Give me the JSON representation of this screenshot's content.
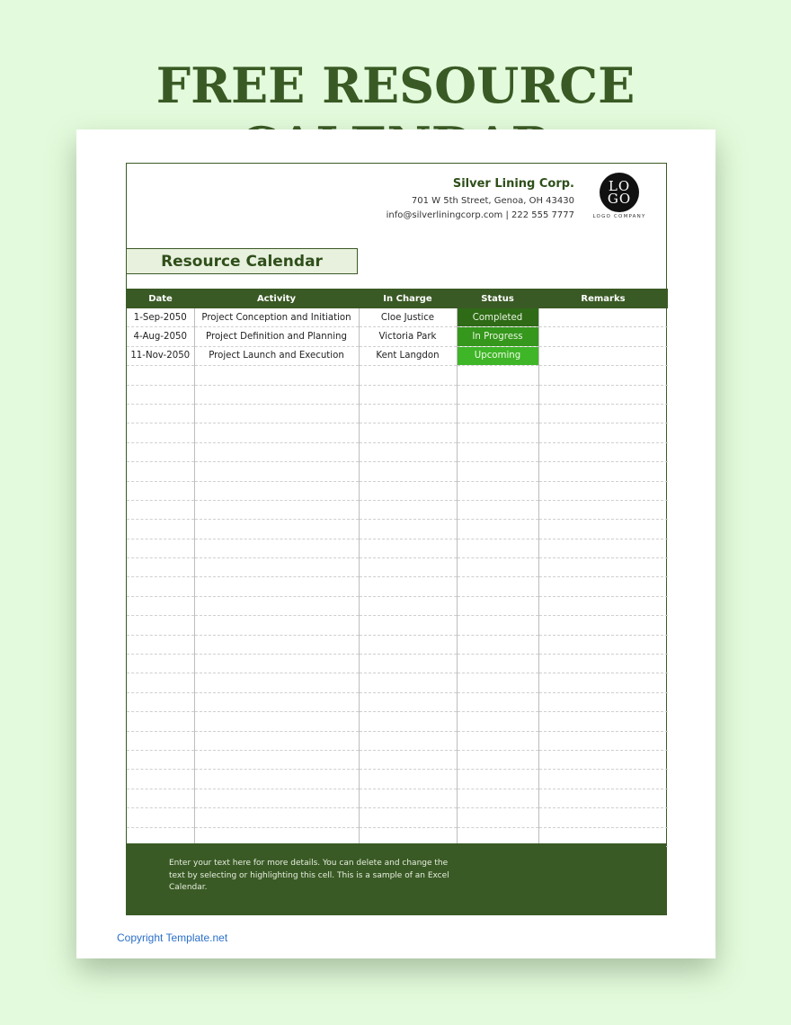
{
  "banner": {
    "title": "FREE RESOURCE CALENDAR"
  },
  "company": {
    "name": "Silver Lining Corp.",
    "address": "701 W 5th Street, Genoa, OH 43430",
    "contact": "info@silverliningcorp.com  |  222 555 7777",
    "logo_top": "LO",
    "logo_bottom": "GO",
    "logo_caption": "LOGO COMPANY"
  },
  "document": {
    "title": "Resource Calendar"
  },
  "table": {
    "columns": [
      "Date",
      "Activity",
      "In Charge",
      "Status",
      "Remarks"
    ],
    "rows": [
      {
        "date": "1-Sep-2050",
        "activity": "Project Conception and Initiation",
        "in_charge": "Cloe Justice",
        "status": "Completed",
        "remarks": ""
      },
      {
        "date": "4-Aug-2050",
        "activity": "Project Definition and Planning",
        "in_charge": "Victoria Park",
        "status": "In Progress",
        "remarks": ""
      },
      {
        "date": "11-Nov-2050",
        "activity": "Project Launch and Execution",
        "in_charge": "Kent Langdon",
        "status": "Upcoming",
        "remarks": ""
      }
    ],
    "empty_row_count": 25,
    "status_colors": {
      "Completed": "#2f6a17",
      "In Progress": "#35971c",
      "Upcoming": "#3fb528"
    }
  },
  "footer": {
    "text": "Enter your text here for more details. You can delete and change the text by selecting or highlighting this cell. This is a sample of an Excel Calendar."
  },
  "copyright": "Copyright Template.net",
  "colors": {
    "brand_green": "#3a5a25",
    "background": "#e3fbdc",
    "link": "#2a6fc9"
  }
}
